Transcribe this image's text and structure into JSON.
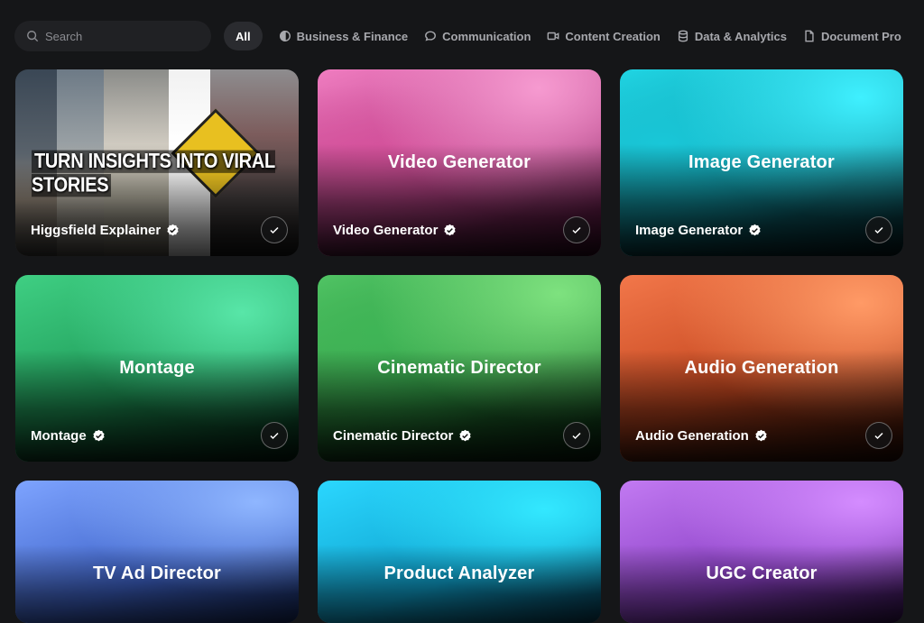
{
  "search": {
    "placeholder": "Search",
    "icon": "search-icon"
  },
  "filters": {
    "all_label": "All",
    "chips": [
      {
        "label": "Business & Finance",
        "icon": "pie-chart-icon"
      },
      {
        "label": "Communication",
        "icon": "chat-bubble-icon"
      },
      {
        "label": "Content Creation",
        "icon": "video-camera-icon"
      },
      {
        "label": "Data & Analytics",
        "icon": "database-icon"
      },
      {
        "label": "Document Pro",
        "icon": "document-icon"
      }
    ]
  },
  "cards": [
    {
      "title": "Higgsfield Explainer",
      "overlay_text": "TURN INSIGHTS INTO VIRAL STORIES",
      "verified": true,
      "selected_check": true
    },
    {
      "title": "Video Generator",
      "center_title": "Video Generator",
      "verified": true,
      "selected_check": true,
      "color": "#e062a8"
    },
    {
      "title": "Image Generator",
      "center_title": "Image Generator",
      "verified": true,
      "selected_check": true,
      "color": "#1fc6d6"
    },
    {
      "title": "Montage",
      "center_title": "Montage",
      "verified": true,
      "selected_check": true,
      "color": "#34b870"
    },
    {
      "title": "Cinematic Director",
      "center_title": "Cinematic Director",
      "verified": true,
      "selected_check": true,
      "color": "#44ab55"
    },
    {
      "title": "Audio Generation",
      "center_title": "Audio Generation",
      "verified": true,
      "selected_check": true,
      "color": "#de5c2e"
    },
    {
      "center_title": "TV Ad Director",
      "color": "#5f86ea"
    },
    {
      "center_title": "Product Analyzer",
      "color": "#20c2ec"
    },
    {
      "center_title": "UGC Creator",
      "color": "#a85cdc"
    }
  ]
}
